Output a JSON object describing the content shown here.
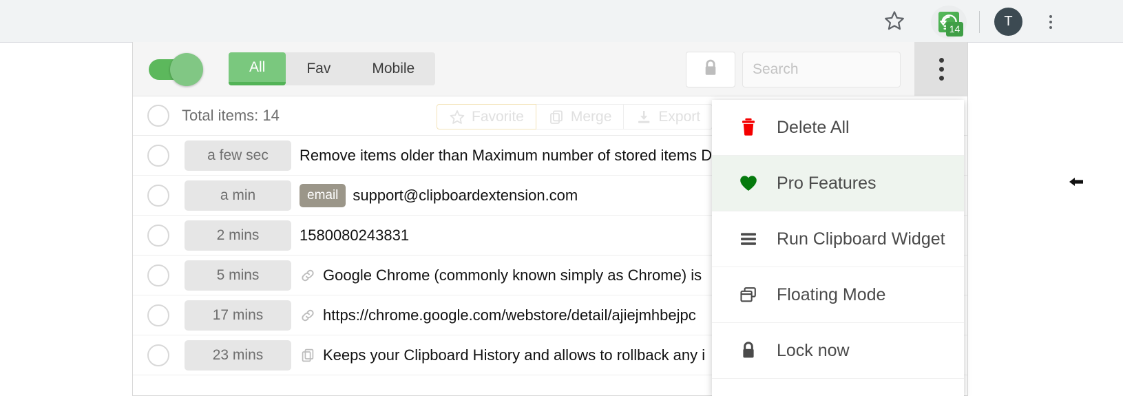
{
  "browser": {
    "star_icon": "star-outline-icon",
    "extension": {
      "icon": "clipboard-history-icon",
      "badge": "14"
    },
    "profile_initial": "T",
    "chrome_menu_icon": "three-dots-vertical-icon"
  },
  "popup": {
    "toggle": {
      "name": "enable-clipboard-toggle",
      "state": "on"
    },
    "tabs": [
      {
        "label": "All",
        "active": true
      },
      {
        "label": "Fav",
        "active": false
      },
      {
        "label": "Mobile",
        "active": false
      }
    ],
    "lock_button": {
      "icon": "lock-icon",
      "label": ""
    },
    "search": {
      "placeholder": "Search",
      "value": "",
      "icon": "search-icon"
    },
    "menu_button": {
      "icon": "three-dots-vertical-icon"
    },
    "action_bar": {
      "select_all": "select-all-checkbox",
      "total_items": "Total items: 14",
      "actions": [
        {
          "label": "Favorite",
          "icon": "star-outline-icon"
        },
        {
          "label": "Merge",
          "icon": "copy-icon"
        },
        {
          "label": "Export",
          "icon": "download-icon"
        }
      ]
    },
    "items": [
      {
        "time": "a few sec",
        "tag": "",
        "icon": "",
        "text": "Remove items older than Maximum number of stored items D"
      },
      {
        "time": "a min",
        "tag": "email",
        "icon": "",
        "text": "support@clipboardextension.com"
      },
      {
        "time": "2 mins",
        "tag": "",
        "icon": "",
        "text": "1580080243831"
      },
      {
        "time": "5 mins",
        "tag": "",
        "icon": "link-icon",
        "text": "Google Chrome (commonly known simply as Chrome) is"
      },
      {
        "time": "17 mins",
        "tag": "",
        "icon": "link-icon",
        "text": "https://chrome.google.com/webstore/detail/ajiejmhbejpc"
      },
      {
        "time": "23 mins",
        "tag": "",
        "icon": "copy-icon",
        "text": "Keeps your Clipboard History and allows to rollback any i"
      }
    ]
  },
  "dropdown": {
    "items": [
      {
        "label": "Delete All",
        "icon": "trash-icon",
        "icon_color": "#f40000",
        "highlight": false
      },
      {
        "label": "Pro Features",
        "icon": "heart-icon",
        "icon_color": "#057a0d",
        "highlight": true
      },
      {
        "label": "Run Clipboard Widget",
        "icon": "hamburger-icon",
        "icon_color": "#4a4a4a",
        "highlight": false
      },
      {
        "label": "Floating Mode",
        "icon": "windows-icon",
        "icon_color": "#4a4a4a",
        "highlight": false
      },
      {
        "label": "Lock now",
        "icon": "lock-icon",
        "icon_color": "#4a4a4a",
        "highlight": false
      }
    ]
  },
  "colors": {
    "accent_green": "#5cb85c",
    "tab_active": "#7ac87e",
    "toolbar_bg": "#f5f5f5",
    "browser_bar": "#f1f3f4",
    "delete_red": "#f40000",
    "pro_green": "#057a0d"
  },
  "cursor": {
    "icon": "left-arrow-cursor"
  }
}
